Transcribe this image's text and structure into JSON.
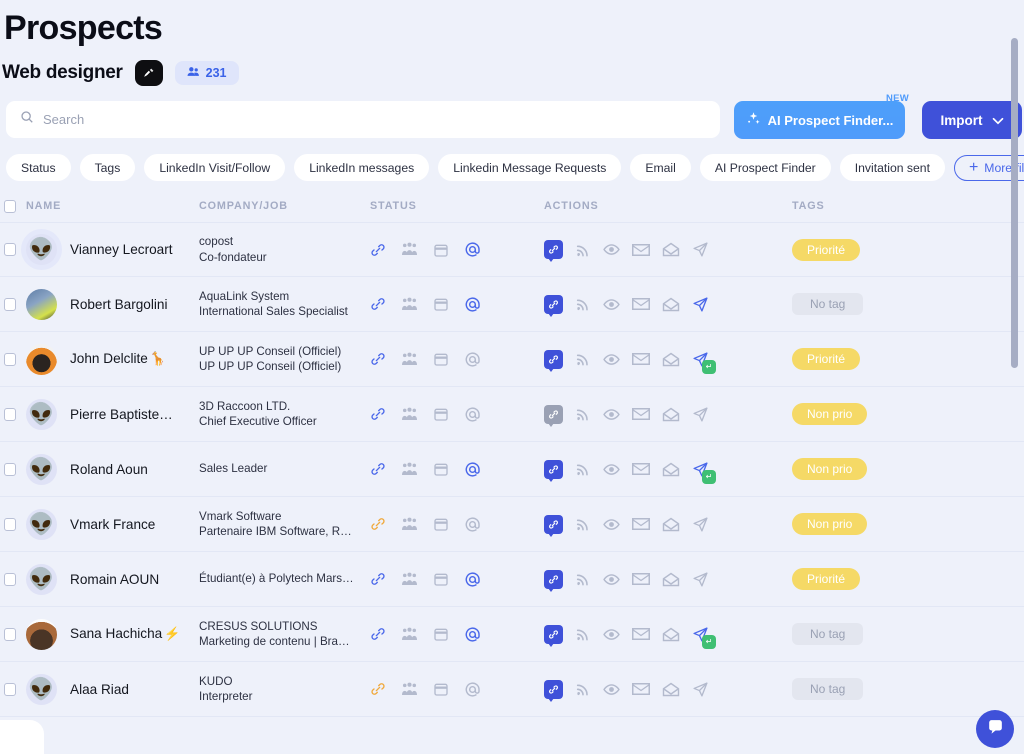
{
  "header": {
    "title": "Prospects",
    "campaign_name": "Web designer",
    "edit_icon": "pen-icon",
    "count_icon": "people-icon",
    "count": "231"
  },
  "search": {
    "placeholder": "Search",
    "value": "",
    "icon": "search-icon"
  },
  "actions": {
    "ai_prospect_finder": "AI Prospect Finder...",
    "ai_icon": "sparkles-icon",
    "new_badge": "NEW",
    "import": "Import",
    "import_chevron": "chevron-down-icon"
  },
  "filters": {
    "chips": [
      "Status",
      "Tags",
      "LinkedIn Visit/Follow",
      "LinkedIn messages",
      "Linkedin Message Requests",
      "Email",
      "AI Prospect Finder",
      "Invitation sent"
    ],
    "more_label": "More filters",
    "more_icon": "plus-icon"
  },
  "table": {
    "columns": [
      "NAME",
      "COMPANY/JOB",
      "STATUS",
      "ACTIONS",
      "TAGS"
    ],
    "status_icons": [
      "link-icon",
      "people-icon",
      "calendar-icon",
      "at-icon"
    ],
    "action_icons": [
      "linkedin-badge-icon",
      "rss-icon",
      "eye-icon",
      "envelope-closed-icon",
      "envelope-open-icon",
      "send-icon"
    ],
    "rows": [
      {
        "avatar": "alien-avatar",
        "avatar_style": "alien halo",
        "name": "Vianney Lecroart",
        "emoji": "",
        "company": "copost",
        "job": "Co-fondateur",
        "status": [
          "on",
          "off",
          "off",
          "on"
        ],
        "actions": {
          "badge": "on",
          "send": "plain"
        },
        "tag": "Priorité",
        "tag_type": "priority"
      },
      {
        "avatar": "photo-avatar",
        "avatar_style": "photo1",
        "name": "Robert Bargolini",
        "emoji": "",
        "company": "AquaLink System",
        "job": "International Sales Specialist",
        "status": [
          "on",
          "off",
          "off",
          "on"
        ],
        "actions": {
          "badge": "on",
          "send": "active"
        },
        "tag": "No tag",
        "tag_type": "none"
      },
      {
        "avatar": "photo-avatar",
        "avatar_style": "photo2",
        "name": "John Delclite",
        "emoji": "🦒",
        "company": "UP UP UP Conseil (Officiel)",
        "job": "UP UP UP Conseil (Officiel)",
        "status": [
          "on",
          "off",
          "off",
          "off"
        ],
        "actions": {
          "badge": "on",
          "send": "active-check"
        },
        "tag": "Priorité",
        "tag_type": "priority"
      },
      {
        "avatar": "alien-avatar",
        "avatar_style": "alien",
        "name": "Pierre Baptiste…",
        "emoji": "",
        "company": "3D Raccoon LTD.",
        "job": "Chief Executive Officer",
        "status": [
          "on",
          "off",
          "off",
          "off"
        ],
        "actions": {
          "badge": "off",
          "send": "plain"
        },
        "tag": "Non prio",
        "tag_type": "priority"
      },
      {
        "avatar": "alien-avatar",
        "avatar_style": "alien",
        "name": "Roland Aoun",
        "emoji": "",
        "company": "",
        "job": "Sales Leader",
        "status": [
          "on",
          "off",
          "off",
          "on"
        ],
        "actions": {
          "badge": "on",
          "send": "active-check"
        },
        "tag": "Non prio",
        "tag_type": "priority"
      },
      {
        "avatar": "alien-avatar",
        "avatar_style": "alien",
        "name": "Vmark France",
        "emoji": "",
        "company": "Vmark Software",
        "job": "Partenaire IBM Software, R…",
        "status": [
          "orange",
          "off",
          "off",
          "off"
        ],
        "actions": {
          "badge": "on",
          "send": "plain"
        },
        "tag": "Non prio",
        "tag_type": "priority"
      },
      {
        "avatar": "alien-avatar",
        "avatar_style": "alien",
        "name": "Romain AOUN",
        "emoji": "",
        "company": "",
        "job": "Étudiant(e) à Polytech Mars…",
        "status": [
          "on",
          "off",
          "off",
          "on"
        ],
        "actions": {
          "badge": "on",
          "send": "plain"
        },
        "tag": "Priorité",
        "tag_type": "priority"
      },
      {
        "avatar": "photo-avatar",
        "avatar_style": "photo3",
        "name": "Sana Hachicha",
        "emoji": "⚡",
        "company": "CRESUS SOLUTIONS",
        "job": "Marketing de contenu | Bra…",
        "status": [
          "on",
          "off",
          "off",
          "on"
        ],
        "actions": {
          "badge": "on",
          "send": "active-check"
        },
        "tag": "No tag",
        "tag_type": "none"
      },
      {
        "avatar": "alien-avatar",
        "avatar_style": "alien",
        "name": "Alaa Riad",
        "emoji": "",
        "company": "KUDO",
        "job": "Interpreter",
        "status": [
          "orange",
          "off",
          "off",
          "off"
        ],
        "actions": {
          "badge": "on",
          "send": "plain"
        },
        "tag": "No tag",
        "tag_type": "none"
      }
    ]
  },
  "chat": {
    "icon": "chat-icon"
  },
  "colors": {
    "background": "#eef1fa",
    "accent_blue": "#3f51d9",
    "ai_blue": "#4f9bfb",
    "tag_yellow": "#f5d966",
    "tag_grey": "#e3e6ef",
    "link_orange": "#f0a93c"
  }
}
